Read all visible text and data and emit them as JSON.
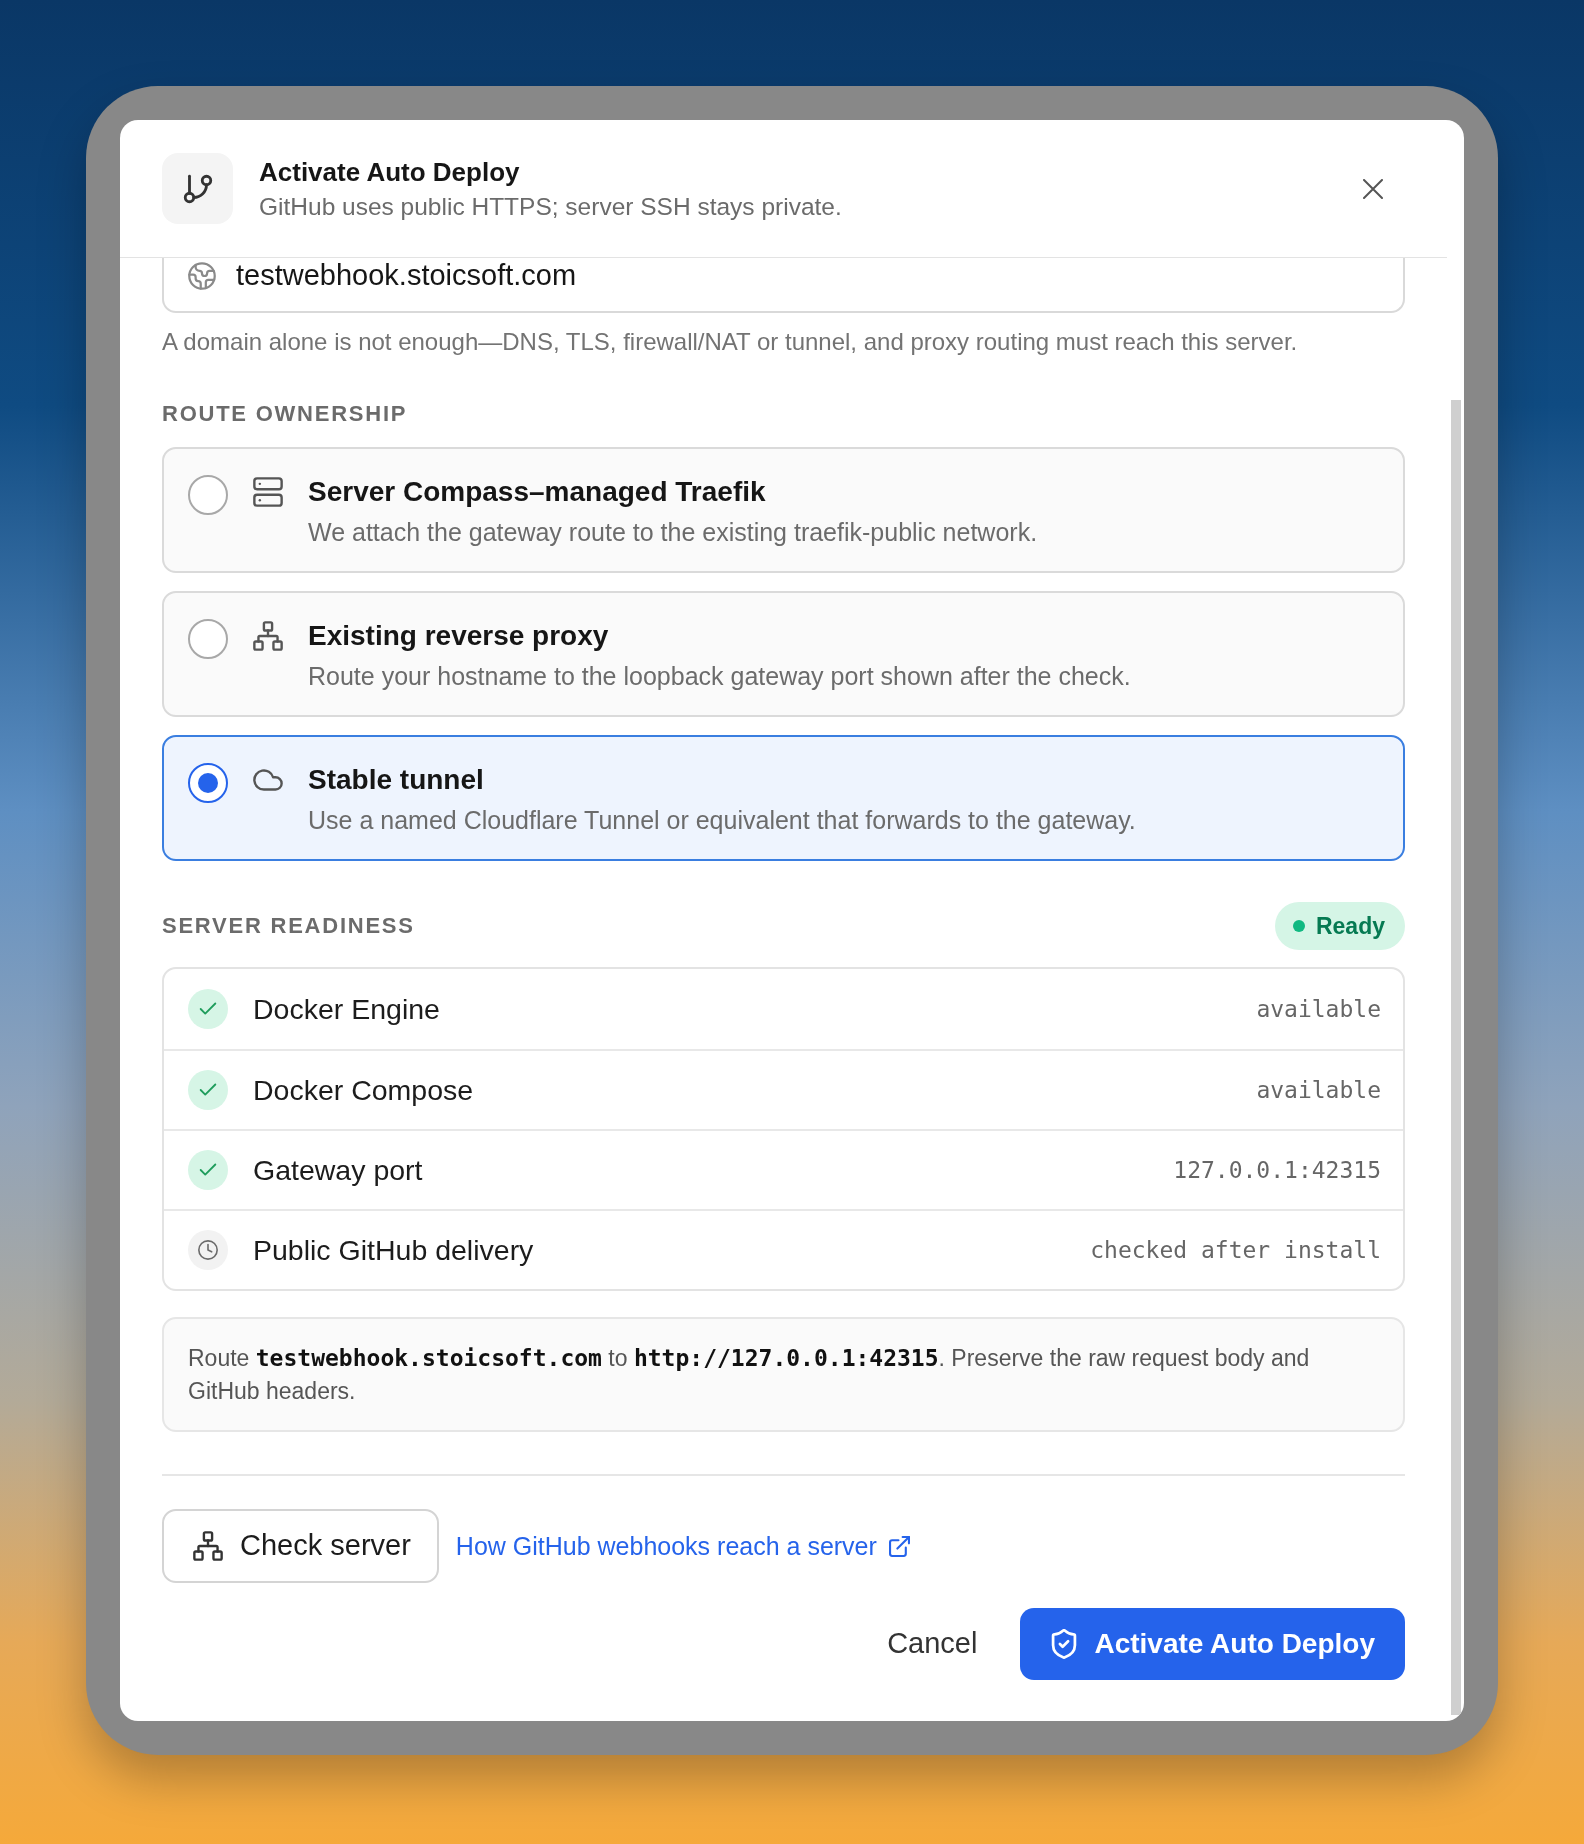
{
  "dialog": {
    "title": "Activate Auto Deploy",
    "subtitle": "GitHub uses public HTTPS; server SSH stays private."
  },
  "domain_field": {
    "value": "testwebhook.stoicsoft.com"
  },
  "domain_hint": "A domain alone is not enough—DNS, TLS, firewall/NAT or tunnel, and proxy routing must reach this server.",
  "route_ownership": {
    "heading": "ROUTE OWNERSHIP",
    "options": [
      {
        "title": "Server Compass–managed Traefik",
        "description": "We attach the gateway route to the existing traefik-public network.",
        "selected": false
      },
      {
        "title": "Existing reverse proxy",
        "description": "Route your hostname to the loopback gateway port shown after the check.",
        "selected": false
      },
      {
        "title": "Stable tunnel",
        "description": "Use a named Cloudflare Tunnel or equivalent that forwards to the gateway.",
        "selected": true
      }
    ]
  },
  "server_readiness": {
    "heading": "SERVER READINESS",
    "status": "Ready",
    "checks": [
      {
        "label": "Docker Engine",
        "value": "available",
        "passed": true
      },
      {
        "label": "Docker Compose",
        "value": "available",
        "passed": true
      },
      {
        "label": "Gateway port",
        "value": "127.0.0.1:42315",
        "passed": true
      },
      {
        "label": "Public GitHub delivery",
        "value": "checked after install",
        "passed": false
      }
    ]
  },
  "route_note": "Route **testwebhook.stoicsoft.com** to **http://127.0.0.1:42315**. Preserve the raw request body and GitHub headers.",
  "actions": {
    "check_server": "Check server",
    "help_link": "How GitHub webhooks reach a server",
    "cancel": "Cancel",
    "activate": "Activate Auto Deploy"
  }
}
